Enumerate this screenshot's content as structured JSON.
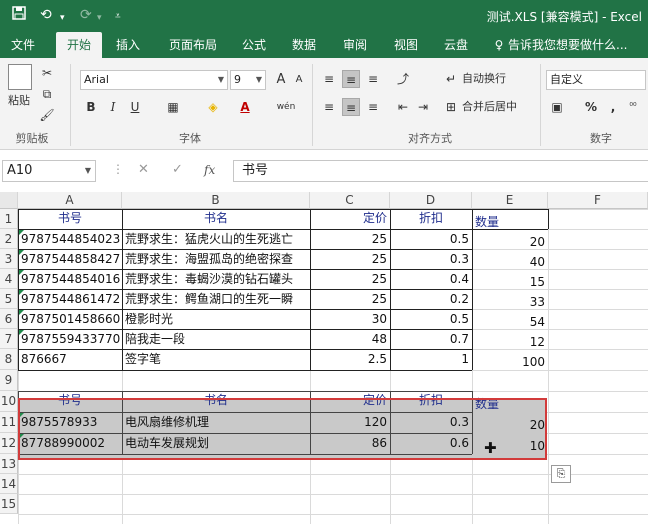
{
  "window": {
    "title": "测试.XLS [兼容模式] - Excel"
  },
  "qat": {
    "save_icon": "save-icon",
    "undo_icon": "undo-icon",
    "redo_icon": "redo-icon",
    "custom_icon": "customize-qat-icon"
  },
  "tabs": [
    "文件",
    "开始",
    "插入",
    "页面布局",
    "公式",
    "数据",
    "审阅",
    "视图",
    "云盘",
    "告诉我您想要做什么..."
  ],
  "active_tab": "开始",
  "ribbon": {
    "clipboard": {
      "paste": "粘贴",
      "label": "剪贴板"
    },
    "font": {
      "name": "Arial",
      "size": "9",
      "label": "字体",
      "bold": "B",
      "italic": "I",
      "underline": "U",
      "phonetic": "wén",
      "grow": "A",
      "shrink": "A"
    },
    "alignment": {
      "wrap": "自动换行",
      "merge": "合并后居中",
      "label": "对齐方式"
    },
    "number": {
      "format": "自定义",
      "label": "数字",
      "percent": "%",
      "comma": ","
    }
  },
  "formula_bar": {
    "name_box": "A10",
    "fx": "fx",
    "content": "书号"
  },
  "columns": [
    "A",
    "B",
    "C",
    "D",
    "E",
    "F"
  ],
  "rows": [
    "1",
    "2",
    "3",
    "4",
    "5",
    "6",
    "7",
    "8",
    "9",
    "10",
    "11",
    "12",
    "13",
    "14",
    "15"
  ],
  "sheet": {
    "r1": [
      "书号",
      "书名",
      "定价",
      "折扣",
      "数量"
    ],
    "data": [
      [
        "9787544854023",
        "荒野求生：猛虎火山的生死逃亡",
        "25",
        "0.5",
        "20"
      ],
      [
        "9787544858427",
        "荒野求生：海盟孤岛的绝密探查",
        "25",
        "0.3",
        "40"
      ],
      [
        "9787544854016",
        "荒野求生：毒蝎沙漠的钻石罐头",
        "25",
        "0.4",
        "15"
      ],
      [
        "9787544861472",
        "荒野求生：鳄鱼湖口的生死一瞬",
        "25",
        "0.2",
        "33"
      ],
      [
        "9787501458660",
        "橙影时光",
        "30",
        "0.5",
        "54"
      ],
      [
        "9787559433770",
        "陪我走一段",
        "48",
        "0.7",
        "12"
      ],
      [
        "876667",
        "签字笔",
        "2.5",
        "1",
        "100"
      ]
    ],
    "r10": [
      "书号",
      "书名",
      "定价",
      "折扣",
      "数量"
    ],
    "r11": [
      "9875578933",
      "电风扇维修机理",
      "120",
      "0.3",
      "20"
    ],
    "r12": [
      "87788990002",
      "电动车发展规划",
      "86",
      "0.6",
      "10"
    ]
  },
  "colors": {
    "excel_green": "#217346",
    "selection_border": "#d23b3b",
    "selection_fill": "#c9c9c9",
    "header_text": "#1f2d8c"
  }
}
